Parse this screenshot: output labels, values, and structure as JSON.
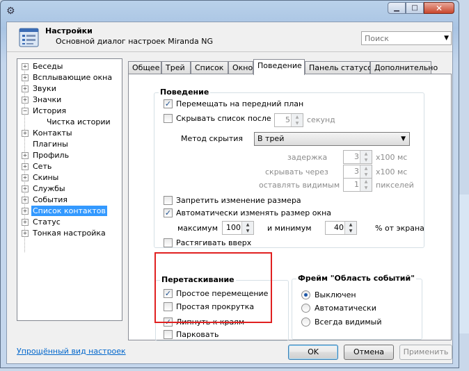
{
  "window": {
    "title": "Настройки",
    "subtitle": "Основной диалог настроек Miranda NG",
    "search_placeholder": "Поиск"
  },
  "tree": [
    {
      "label": "Беседы",
      "expander": "+"
    },
    {
      "label": "Всплывающие окна",
      "expander": "+"
    },
    {
      "label": "Звуки",
      "expander": "+"
    },
    {
      "label": "Значки",
      "expander": "+"
    },
    {
      "label": "История",
      "expander": "−"
    },
    {
      "label": "Чистка истории",
      "expander": ""
    },
    {
      "label": "Контакты",
      "expander": "+"
    },
    {
      "label": "Плагины",
      "expander": ""
    },
    {
      "label": "Профиль",
      "expander": "+"
    },
    {
      "label": "Сеть",
      "expander": "+"
    },
    {
      "label": "Скины",
      "expander": "+"
    },
    {
      "label": "Службы",
      "expander": "+"
    },
    {
      "label": "События",
      "expander": "+"
    },
    {
      "label": "Список контактов",
      "expander": "+"
    },
    {
      "label": "Статус",
      "expander": "+"
    },
    {
      "label": "Тонкая настройка",
      "expander": "+"
    }
  ],
  "simple_view_link": "Упрощённый вид настроек",
  "tabs": [
    "Общее",
    "Трей",
    "Список",
    "Окно",
    "Поведение",
    "Панель статусов",
    "Дополнительно"
  ],
  "behavior": {
    "title": "Поведение",
    "bring_to_front": "Перемещать на передний план",
    "hide_list_after": "Скрывать список после",
    "hide_seconds": "5",
    "seconds_label": "секунд",
    "hide_method_label": "Метод скрытия",
    "hide_method_value": "В трей",
    "delay_label": "задержка",
    "delay_value": "3",
    "hide_through_label": "скрывать через",
    "hide_through_value": "3",
    "leave_visible_label": "оставлять видимым",
    "leave_visible_value": "1",
    "unit_x100ms": "x100 мс",
    "unit_pixels": "пикселей",
    "prevent_resize": "Запретить изменение размера",
    "auto_resize": "Автоматически изменять размер окна",
    "max_label": "максимум",
    "max_value": "100",
    "min_label": "и минимум",
    "min_value": "40",
    "percent_label": "% от экрана",
    "stretch_up": "Растягивать вверх"
  },
  "dragging": {
    "title": "Перетаскивание",
    "simple_move": "Простое перемещение",
    "simple_scroll": "Простая прокрутка",
    "snap_edges": "Липнуть к краям",
    "dock": "Парковать"
  },
  "event_frame": {
    "title": "Фрейм \"Область событий\"",
    "off": "Выключен",
    "auto": "Автоматически",
    "always": "Всегда видимый"
  },
  "buttons": {
    "ok": "OK",
    "cancel": "Отмена",
    "apply": "Применить"
  }
}
